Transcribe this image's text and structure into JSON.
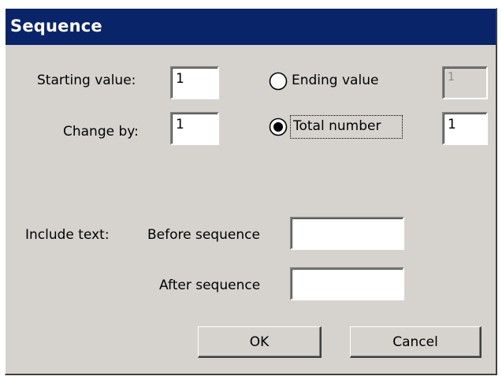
{
  "window": {
    "title": "Sequence"
  },
  "fields": {
    "starting_value_label": "Starting value:",
    "starting_value": "1",
    "change_by_label": "Change by:",
    "change_by": "1",
    "ending_value_value": "1",
    "total_number_value": "1"
  },
  "options": {
    "ending_value_label": "Ending value",
    "ending_value_selected": false,
    "total_number_label": "Total number",
    "total_number_selected": true
  },
  "include_text": {
    "label": "Include text:",
    "before_label": "Before sequence",
    "before_value": "",
    "after_label": "After sequence",
    "after_value": ""
  },
  "buttons": {
    "ok_label": "OK",
    "cancel_label": "Cancel"
  },
  "colors": {
    "titlebar": "#0a246a",
    "dialog_face": "#d6d3ce"
  }
}
